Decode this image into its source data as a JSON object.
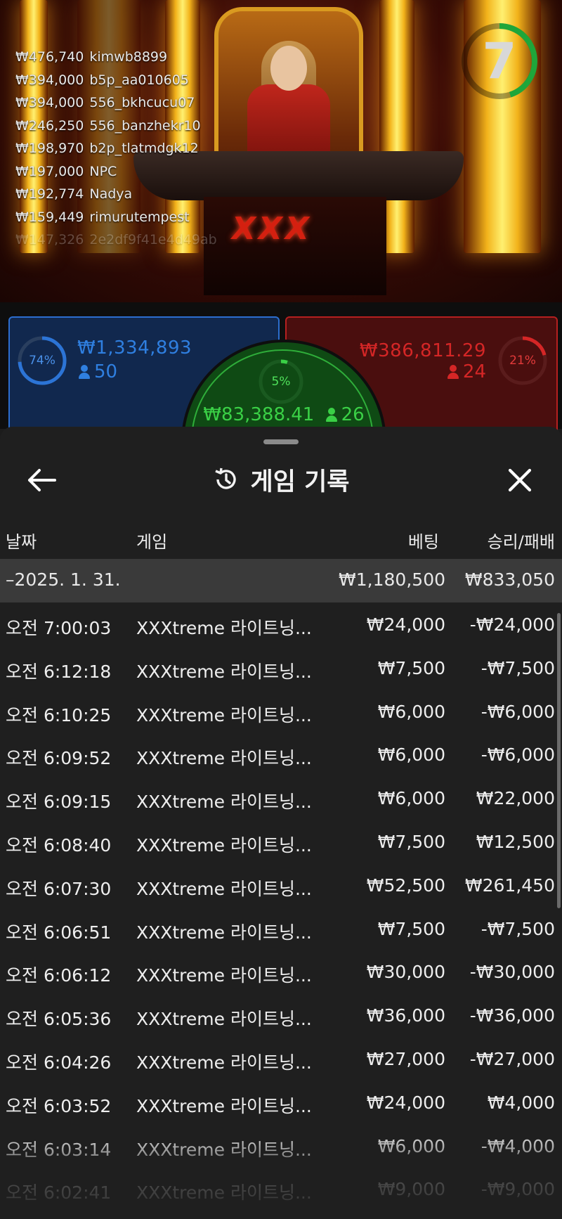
{
  "leaderboard": [
    {
      "amount": "₩476,740",
      "user": "kimwb8899"
    },
    {
      "amount": "₩394,000",
      "user": "b5p_aa010605"
    },
    {
      "amount": "₩394,000",
      "user": "556_bkhcucu07"
    },
    {
      "amount": "₩246,250",
      "user": "556_banzhekr10"
    },
    {
      "amount": "₩198,970",
      "user": "b2p_tlatmdgk12"
    },
    {
      "amount": "₩197,000",
      "user": "NPC"
    },
    {
      "amount": "₩192,774",
      "user": "Nadya"
    },
    {
      "amount": "₩159,449",
      "user": "rimurutempest"
    },
    {
      "amount": "₩147,326",
      "user": "2e2df9f41e4d49ab"
    }
  ],
  "timer": {
    "value": "7",
    "fraction": 0.45,
    "color": "#1fa63a"
  },
  "logo_text": "XXX",
  "bets": {
    "player": {
      "percent": "74%",
      "percent_value": 0.74,
      "amount": "₩1,334,893",
      "count": "50",
      "color": "#2c74d6"
    },
    "banker": {
      "percent": "21%",
      "percent_value": 0.21,
      "amount": "₩386,811.29",
      "count": "24",
      "color": "#d42626"
    },
    "tie": {
      "percent": "5%",
      "percent_value": 0.05,
      "amount": "₩83,388.41",
      "count": "26",
      "color": "#3ad046"
    }
  },
  "history": {
    "title": "게임 기록",
    "icons": {
      "back": "back-arrow-icon",
      "history": "history-clock-icon",
      "close": "close-icon"
    },
    "columns": {
      "date": "날짜",
      "game": "게임",
      "bet": "베팅",
      "result": "승리/패배"
    },
    "date_group": {
      "label": "–2025. 1. 31.",
      "bet": "₩1,180,500",
      "result": "₩833,050"
    },
    "rows": [
      {
        "time": "오전 7:00:03",
        "game": "XXXtreme 라이트닝...",
        "bet": "₩24,000",
        "result": "-₩24,000"
      },
      {
        "time": "오전 6:12:18",
        "game": "XXXtreme 라이트닝...",
        "bet": "₩7,500",
        "result": "-₩7,500"
      },
      {
        "time": "오전 6:10:25",
        "game": "XXXtreme 라이트닝...",
        "bet": "₩6,000",
        "result": "-₩6,000"
      },
      {
        "time": "오전 6:09:52",
        "game": "XXXtreme 라이트닝...",
        "bet": "₩6,000",
        "result": "-₩6,000"
      },
      {
        "time": "오전 6:09:15",
        "game": "XXXtreme 라이트닝...",
        "bet": "₩6,000",
        "result": "₩22,000"
      },
      {
        "time": "오전 6:08:40",
        "game": "XXXtreme 라이트닝...",
        "bet": "₩7,500",
        "result": "₩12,500"
      },
      {
        "time": "오전 6:07:30",
        "game": "XXXtreme 라이트닝...",
        "bet": "₩52,500",
        "result": "₩261,450"
      },
      {
        "time": "오전 6:06:51",
        "game": "XXXtreme 라이트닝...",
        "bet": "₩7,500",
        "result": "-₩7,500"
      },
      {
        "time": "오전 6:06:12",
        "game": "XXXtreme 라이트닝...",
        "bet": "₩30,000",
        "result": "-₩30,000"
      },
      {
        "time": "오전 6:05:36",
        "game": "XXXtreme 라이트닝...",
        "bet": "₩36,000",
        "result": "-₩36,000"
      },
      {
        "time": "오전 6:04:26",
        "game": "XXXtreme 라이트닝...",
        "bet": "₩27,000",
        "result": "-₩27,000"
      },
      {
        "time": "오전 6:03:52",
        "game": "XXXtreme 라이트닝...",
        "bet": "₩24,000",
        "result": "₩4,000"
      },
      {
        "time": "오전 6:03:14",
        "game": "XXXtreme 라이트닝...",
        "bet": "₩6,000",
        "result": "-₩4,000"
      },
      {
        "time": "오전 6:02:41",
        "game": "XXXtreme 라이트닝...",
        "bet": "₩9,000",
        "result": "-₩9,000"
      }
    ]
  }
}
